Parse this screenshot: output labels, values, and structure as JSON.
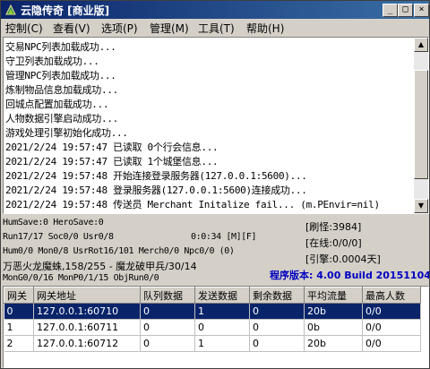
{
  "window": {
    "title": "云隐传奇 [商业版]",
    "minimize_glyph": "_",
    "maximize_glyph": "□",
    "close_glyph": "×"
  },
  "menu": [
    "控制(C)",
    "查看(V)",
    "选项(P)",
    "管理(M)",
    "工具(T)",
    "帮助(H)"
  ],
  "log_lines": [
    "交易NPC列表加载成功...",
    "守卫列表加载成功...",
    "管理NPC列表加载成功...",
    "炼制物品信息加载成功...",
    "回城点配置加载成功...",
    "人物数据引擎启动成功...",
    "游戏处理引擎初始化成功...",
    "2021/2/24 19:57:47 已读取 0个行会信息...",
    "2021/2/24 19:57:47 已读取 1个城堡信息...",
    "2021/2/24 19:57:48 开始连接登录服务器(127.0.0.1:5600)...",
    "2021/2/24 19:57:48 登录服务器(127.0.0.1:5600)连接成功...",
    "2021/2/24 19:57:48 传送员 Merchant Initalize fail... (m.PEnvir=nil)"
  ],
  "status": {
    "line1": "HumSave:0 HeroSave:0",
    "line2": "Run17/17 Soc0/0 Usr0/8",
    "timer": "0:0:34 [M][F]",
    "line3": "Hum0/0 Mon0/8 UsrRot16/101 Merch0/0 Npc0/0 (0)",
    "line4": "万恶火龙魔蛛,158/255 - 魔龙破甲兵/30/14",
    "line5": "MonG0/0/16 MonP0/1/15 ObjRun0/0",
    "refresh_monster": "[刷怪:3984]",
    "online": "[在线:0/0/0]",
    "engine": "[引擎:0.0004天]",
    "version": "程序版本: 4.00 Build 20151104"
  },
  "gateway_table": {
    "columns": [
      "网关",
      "网关地址",
      "队列数据",
      "发送数据",
      "剩余数据",
      "平均流量",
      "最高人数"
    ],
    "rows": [
      [
        "0",
        "127.0.0.1:60710",
        "0",
        "1",
        "0",
        "20b",
        "0/0"
      ],
      [
        "1",
        "127.0.0.1:60711",
        "0",
        "0",
        "0",
        "0b",
        "0/0"
      ],
      [
        "2",
        "127.0.0.1:60712",
        "0",
        "1",
        "0",
        "20b",
        "0/0"
      ]
    ]
  },
  "colors": {
    "title_bar": "#0a246a",
    "selection": "#0a246a",
    "version_text": "#0000c0"
  }
}
